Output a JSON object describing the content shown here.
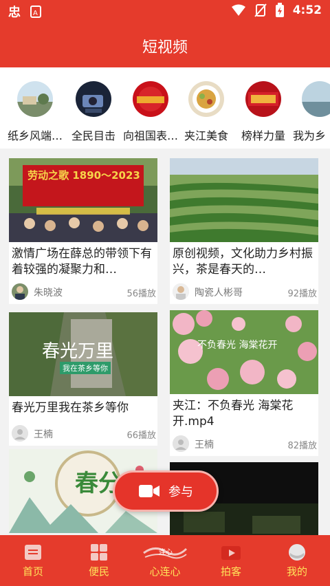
{
  "status": {
    "time": "4:52"
  },
  "header": {
    "title": "短视频"
  },
  "categories": [
    {
      "label": "纸乡风端…"
    },
    {
      "label": "全民目击"
    },
    {
      "label": "向祖国表…"
    },
    {
      "label": "夹江美食"
    },
    {
      "label": "榜样力量"
    },
    {
      "label": "我为乡"
    }
  ],
  "videos": [
    {
      "title": "激情广场在薛总的带领下有着较强的凝聚力和…",
      "author": "朱晓波",
      "plays": "56播放",
      "thumb_text": "劳动之歌 1890～2023"
    },
    {
      "title": "原创视频，文化助力乡村振兴，茶是春天的…",
      "author": "陶瓷人彬哥",
      "plays": "92播放",
      "thumb_text": ""
    },
    {
      "title": "春光万里我在茶乡等你",
      "author": "王楠",
      "plays": "66播放",
      "thumb_text": "春光万里",
      "thumb_sub": "我在茶乡等你"
    },
    {
      "title": "夹江：不负春光 海棠花开.mp4",
      "author": "王楠",
      "plays": "82播放",
      "thumb_text": "不负春光 海棠花开"
    },
    {
      "title": "",
      "author": "",
      "plays": "",
      "thumb_text": "春分"
    },
    {
      "title": "",
      "author": "",
      "plays": "",
      "thumb_text": ""
    }
  ],
  "join": {
    "label": "参与"
  },
  "tabs": [
    {
      "label": "首页",
      "icon": "home-icon"
    },
    {
      "label": "便民",
      "icon": "grid-icon"
    },
    {
      "label": "心连心",
      "icon": "heart-connect-icon",
      "logo_text": "连心"
    },
    {
      "label": "拍客",
      "icon": "video-camera-icon"
    },
    {
      "label": "我的",
      "icon": "profile-icon"
    }
  ],
  "colors": {
    "brand": "#e53b2c",
    "tab_label": "#ffe45a"
  }
}
